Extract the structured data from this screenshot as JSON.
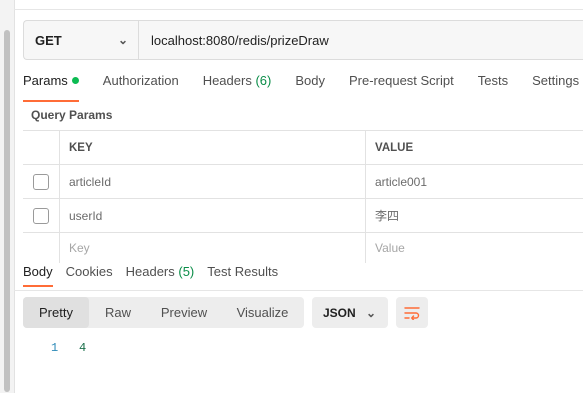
{
  "request": {
    "method": "GET",
    "url": "localhost:8080/redis/prizeDraw"
  },
  "request_tabs": [
    {
      "label": "Params"
    },
    {
      "label": "Authorization"
    },
    {
      "label": "Headers",
      "count": "(6)"
    },
    {
      "label": "Body"
    },
    {
      "label": "Pre-request Script"
    },
    {
      "label": "Tests"
    },
    {
      "label": "Settings"
    }
  ],
  "query_params": {
    "title": "Query Params",
    "columns": {
      "key": "KEY",
      "value": "VALUE"
    },
    "rows": [
      {
        "key": "articleId",
        "value": "article001"
      },
      {
        "key": "userId",
        "value": "李四"
      }
    ],
    "placeholder": {
      "key": "Key",
      "value": "Value"
    }
  },
  "response_tabs": [
    {
      "label": "Body"
    },
    {
      "label": "Cookies"
    },
    {
      "label": "Headers",
      "count": "(5)"
    },
    {
      "label": "Test Results"
    }
  ],
  "view_modes": [
    "Pretty",
    "Raw",
    "Preview",
    "Visualize"
  ],
  "format": "JSON",
  "response_body": {
    "line_number": "1",
    "content": "4"
  },
  "colors": {
    "accent": "#ff6c37",
    "active_dot": "#0cbb52",
    "count": "#0a8d48"
  }
}
